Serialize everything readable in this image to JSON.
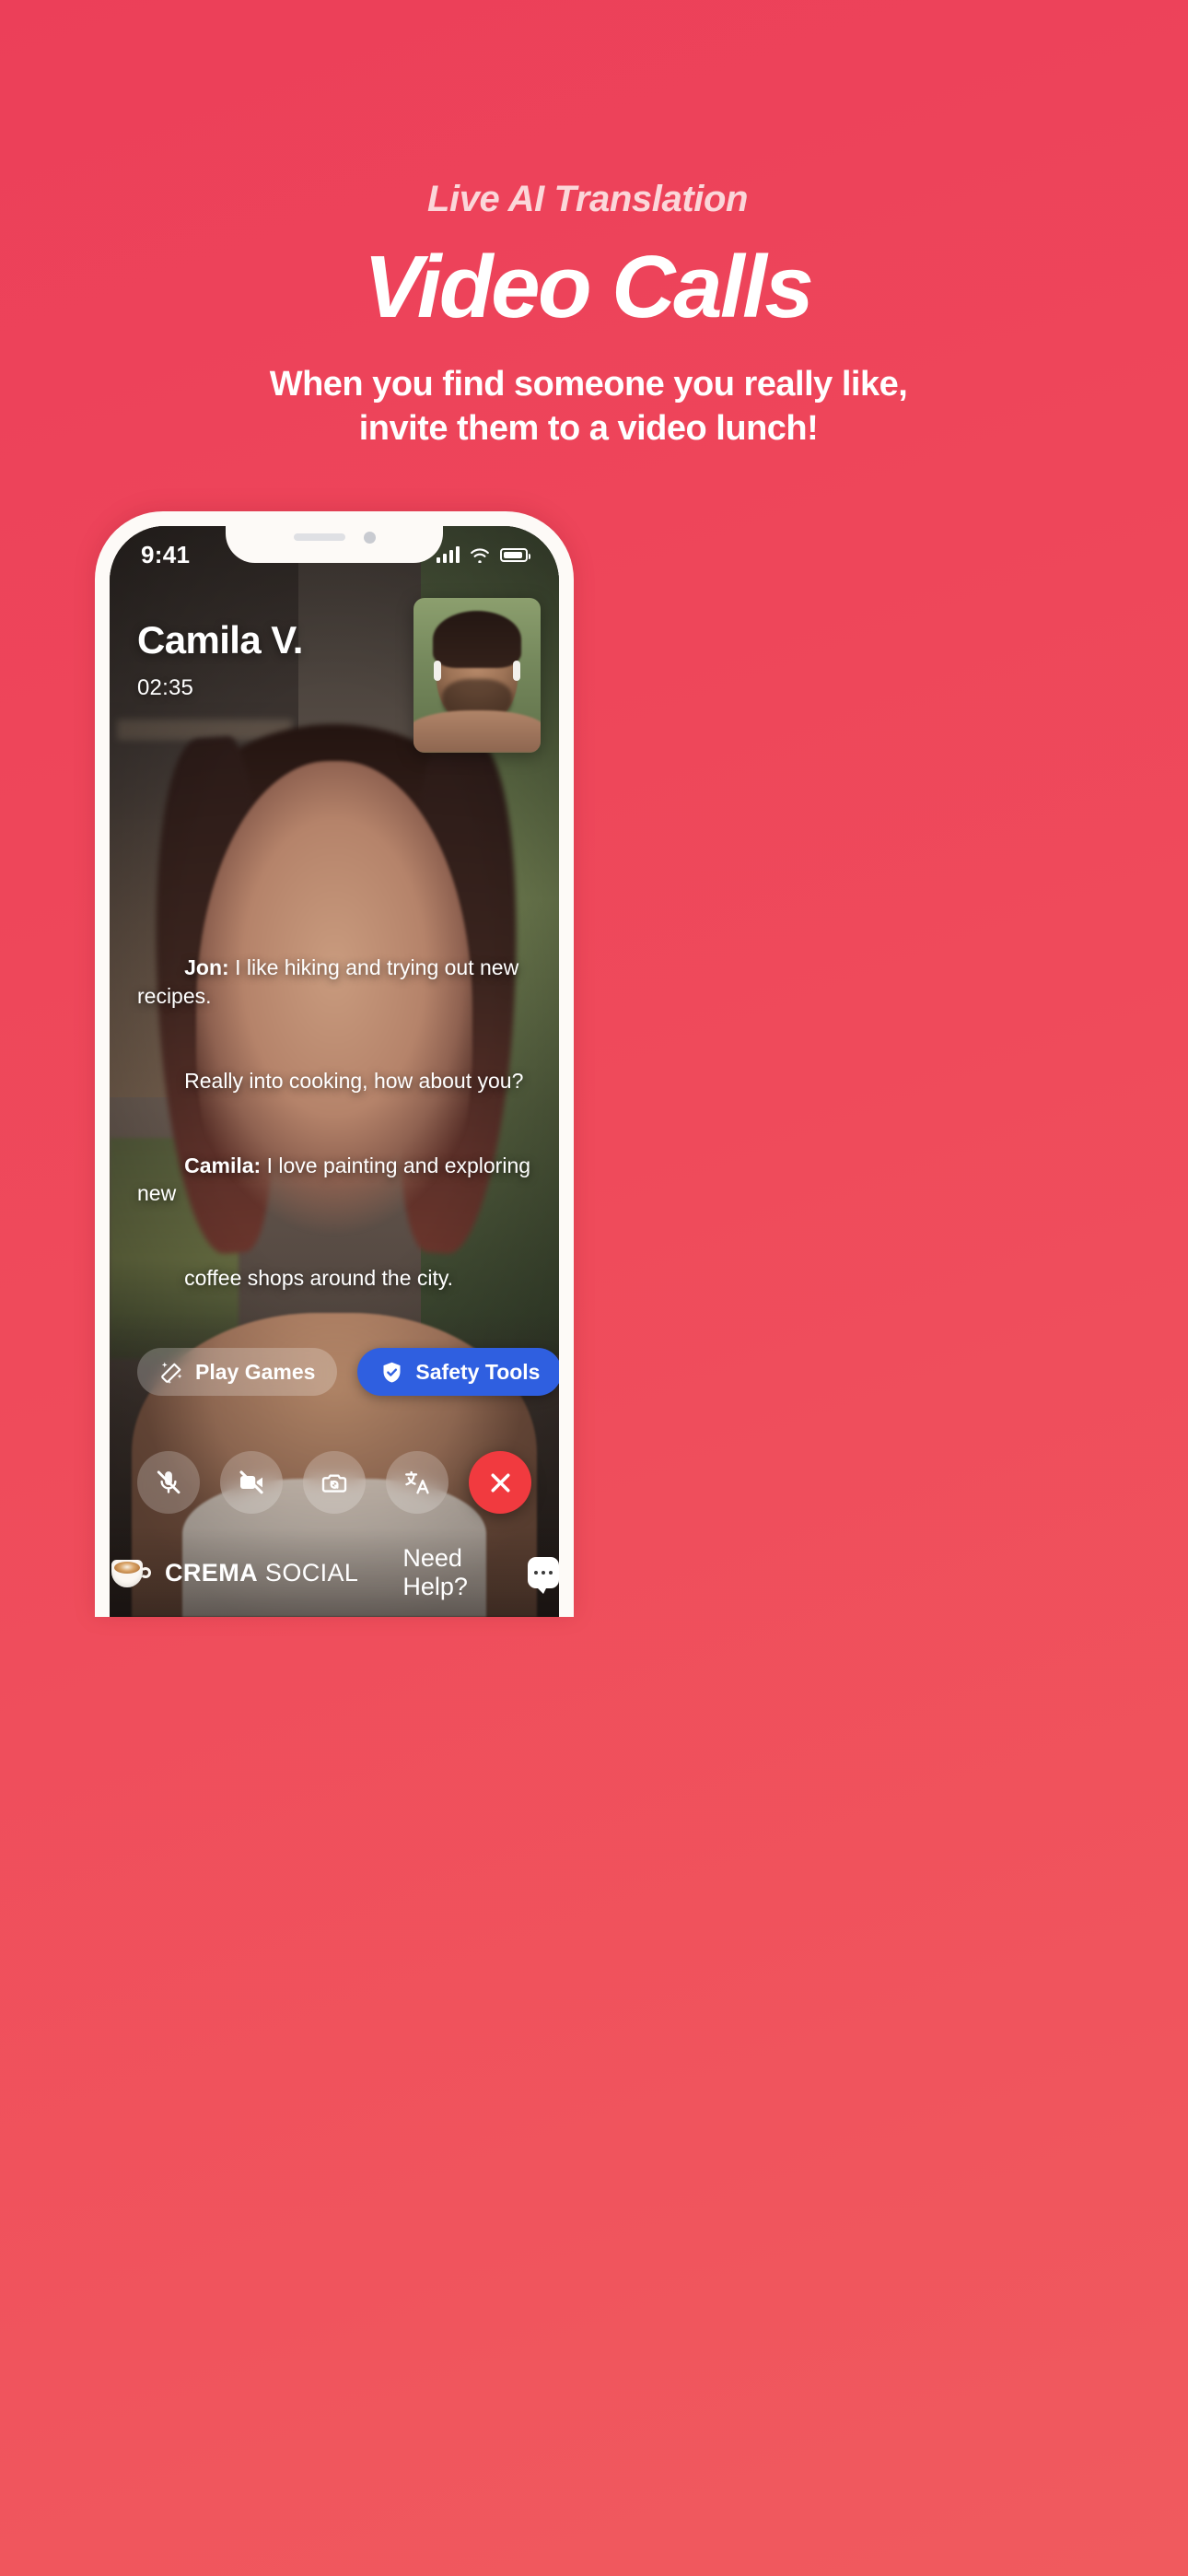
{
  "theme": {
    "background_red": "#EC3F59",
    "accent_blue": "#2F5FE0",
    "end_call_red": "#F13A3F",
    "eyebrow_pink": "#FBD7DA"
  },
  "headline": {
    "eyebrow": "Live AI Translation",
    "title": "Video Calls",
    "subtitle_line1": "When you find someone you really like,",
    "subtitle_line2": "invite them to a video lunch!"
  },
  "phone": {
    "status_bar": {
      "time": "9:41",
      "cellular_icon": "signal-bars-icon",
      "wifi_icon": "wifi-icon",
      "battery_icon": "battery-icon"
    },
    "call": {
      "caller_name": "Camila V.",
      "timer": "02:35",
      "self_view_label": "self-video-preview"
    },
    "captions": [
      {
        "speaker": "Jon:",
        "text": " I like hiking and trying out new recipes."
      },
      {
        "speaker": "",
        "text": "Really into cooking, how about you?"
      },
      {
        "speaker": "Camila:",
        "text": " I love painting and exploring new"
      },
      {
        "speaker": "",
        "text": "coffee shops around the city."
      }
    ],
    "pills": [
      {
        "label": "Play Games",
        "icon": "magic-wand-icon",
        "style": "ghost"
      },
      {
        "label": "Safety Tools",
        "icon": "shield-check-icon",
        "style": "blue"
      }
    ],
    "controls": [
      {
        "name": "mute-microphone-button",
        "icon": "microphone-muted-icon"
      },
      {
        "name": "stop-video-button",
        "icon": "video-camera-off-icon"
      },
      {
        "name": "flip-camera-button",
        "icon": "camera-flip-icon"
      },
      {
        "name": "translate-button",
        "icon": "translate-icon"
      },
      {
        "name": "end-call-button",
        "icon": "close-x-icon"
      }
    ],
    "footer": {
      "brand_bold": "CREMA",
      "brand_light": "SOCIAL",
      "brand_icon": "coffee-cup-icon",
      "help_label": "Need Help?",
      "help_icon": "chat-bubble-icon"
    }
  }
}
